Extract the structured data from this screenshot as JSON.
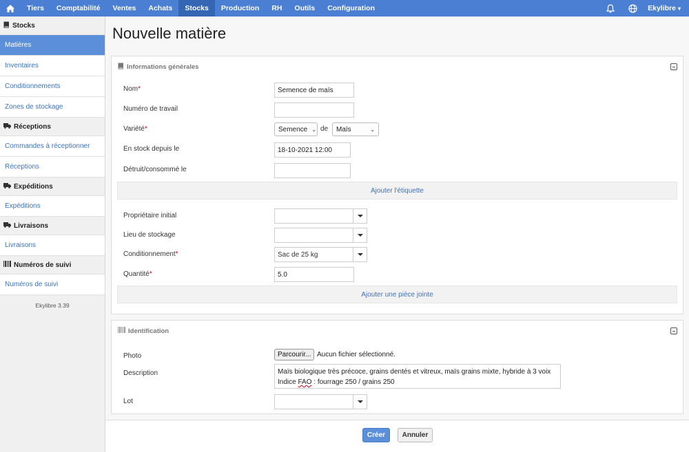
{
  "nav": {
    "items": [
      "Tiers",
      "Comptabilité",
      "Ventes",
      "Achats",
      "Stocks",
      "Production",
      "RH",
      "Outils",
      "Configuration"
    ],
    "active": "Stocks",
    "user": "Ekylibre"
  },
  "sidebar": {
    "sections": [
      {
        "title": "Stocks",
        "icon": "book-icon",
        "links": [
          "Matières",
          "Inventaires",
          "Conditionnements",
          "Zones de stockage"
        ]
      },
      {
        "title": "Réceptions",
        "icon": "truck-icon",
        "links": [
          "Commandes à réceptionner",
          "Réceptions"
        ]
      },
      {
        "title": "Expéditions",
        "icon": "truck-icon",
        "links": [
          "Expéditions"
        ]
      },
      {
        "title": "Livraisons",
        "icon": "truck-icon",
        "links": [
          "Livraisons"
        ]
      },
      {
        "title": "Numéros de suivi",
        "icon": "barcode-icon",
        "links": [
          "Numéros de suivi"
        ]
      }
    ],
    "active_link": "Matières",
    "version": "Ekylibre 3.39"
  },
  "page": {
    "title": "Nouvelle matière"
  },
  "general": {
    "title": "Informations générales",
    "nom_label": "Nom",
    "nom_value": "Semence de maïs",
    "numero_label": "Numéro de travail",
    "numero_value": "",
    "variete_label": "Variété",
    "variete_value": "Semence",
    "de_label": "de",
    "variete_of_value": "Maïs",
    "stock_label": "En stock depuis le",
    "stock_value": "18-10-2021 12:00",
    "detruit_label": "Détruit/consommé le",
    "detruit_value": "",
    "add_label": "Ajouter l'étiquette",
    "proprietaire_label": "Propriétaire initial",
    "proprietaire_value": "",
    "lieu_label": "Lieu de stockage",
    "lieu_value": "",
    "conditionnement_label": "Conditionnement",
    "conditionnement_value": "Sac de 25 kg",
    "quantite_label": "Quantité",
    "quantite_value": "5.0",
    "attach_label": "Ajouter une pièce jointe"
  },
  "identification": {
    "title": "Identification",
    "photo_label": "Photo",
    "browse_label": "Parcourir...",
    "no_file": "Aucun fichier sélectionné.",
    "description_label": "Description",
    "description_line1": "Maïs biologique très précoce, grains dentés et vitreux, maïs grains mixte, hybride à 3 voix",
    "description_line2_pre": "Indice ",
    "description_line2_word": "FAO",
    "description_line2_post": " : fourrage 250 / grains 250",
    "lot_label": "Lot",
    "lot_value": ""
  },
  "actions": {
    "create": "Créer",
    "cancel": "Annuler"
  }
}
